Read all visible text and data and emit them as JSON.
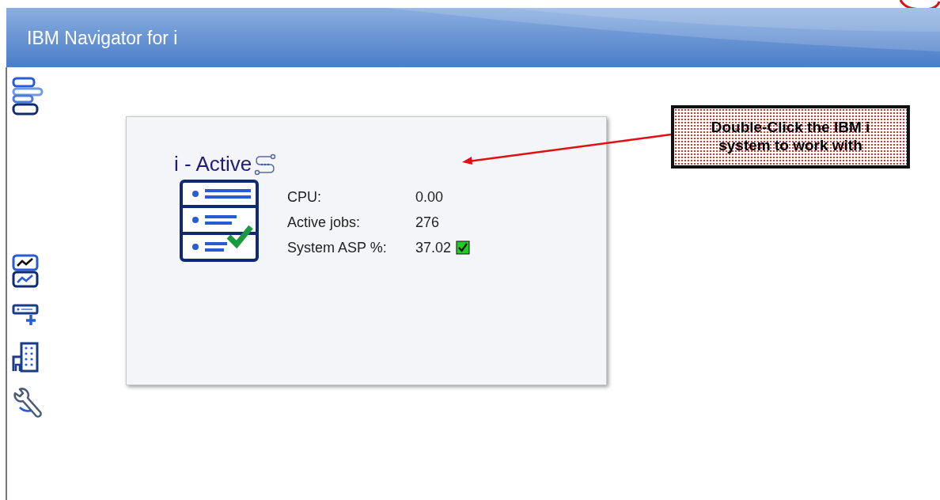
{
  "window": {
    "title": "IBM Navigator for i"
  },
  "system_card": {
    "title": "i - Active",
    "metrics": [
      {
        "label": "CPU:",
        "value": "0.00",
        "checked": false
      },
      {
        "label": "Active jobs:",
        "value": "276",
        "checked": false
      },
      {
        "label": "System ASP %:",
        "value": "37.02",
        "checked": true
      }
    ]
  },
  "callout": {
    "text": "Double-Click the IBM i system to work with"
  }
}
